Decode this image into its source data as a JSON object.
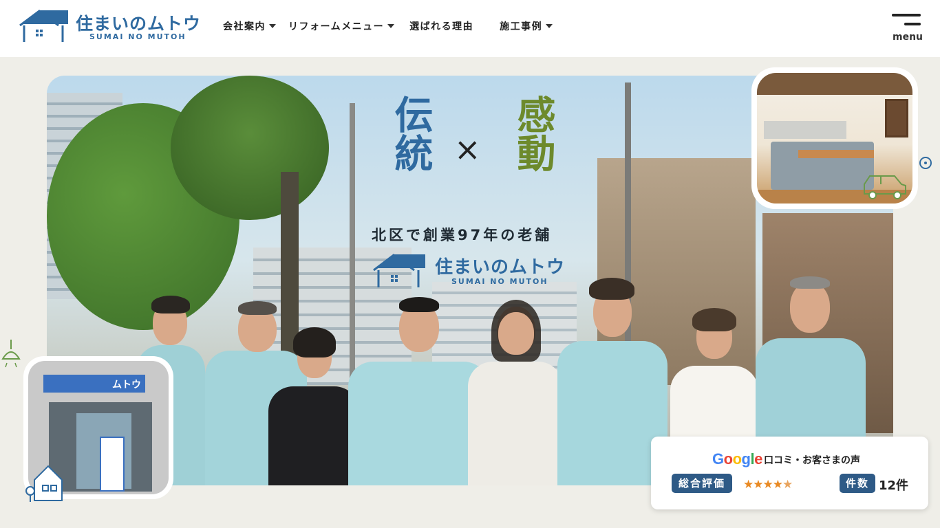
{
  "brand": {
    "name_jp": "住まいのムトウ",
    "name_en": "SUMAI NO MUTOH",
    "color": "#2f6aa0"
  },
  "nav": {
    "items": [
      {
        "label": "会社案内",
        "has_dropdown": true
      },
      {
        "label": "リフォームメニュー",
        "has_dropdown": true
      },
      {
        "label": "選ばれる理由",
        "has_dropdown": false
      },
      {
        "label": "施工事例",
        "has_dropdown": true
      }
    ],
    "menu_label": "menu"
  },
  "hero": {
    "catch_left": "伝統",
    "catch_cross": "×",
    "catch_right": "感動",
    "tagline": "北区で創業97年の老舗",
    "logo_jp": "住まいのムトウ",
    "logo_en": "SUMAI NO MUTOH",
    "shop_sign": "ムトウ",
    "colors": {
      "blue": "#2f6aa0",
      "green": "#6d8a2c"
    }
  },
  "review": {
    "google": "Google",
    "label": "口コミ・お客さまの声",
    "rating_label": "総合評価",
    "rating": 4.5,
    "stars": "★★★★",
    "half_star": "★",
    "count_label": "件数",
    "count": "12件",
    "star_color": "#e98a24",
    "badge_color": "#2e5a86"
  }
}
